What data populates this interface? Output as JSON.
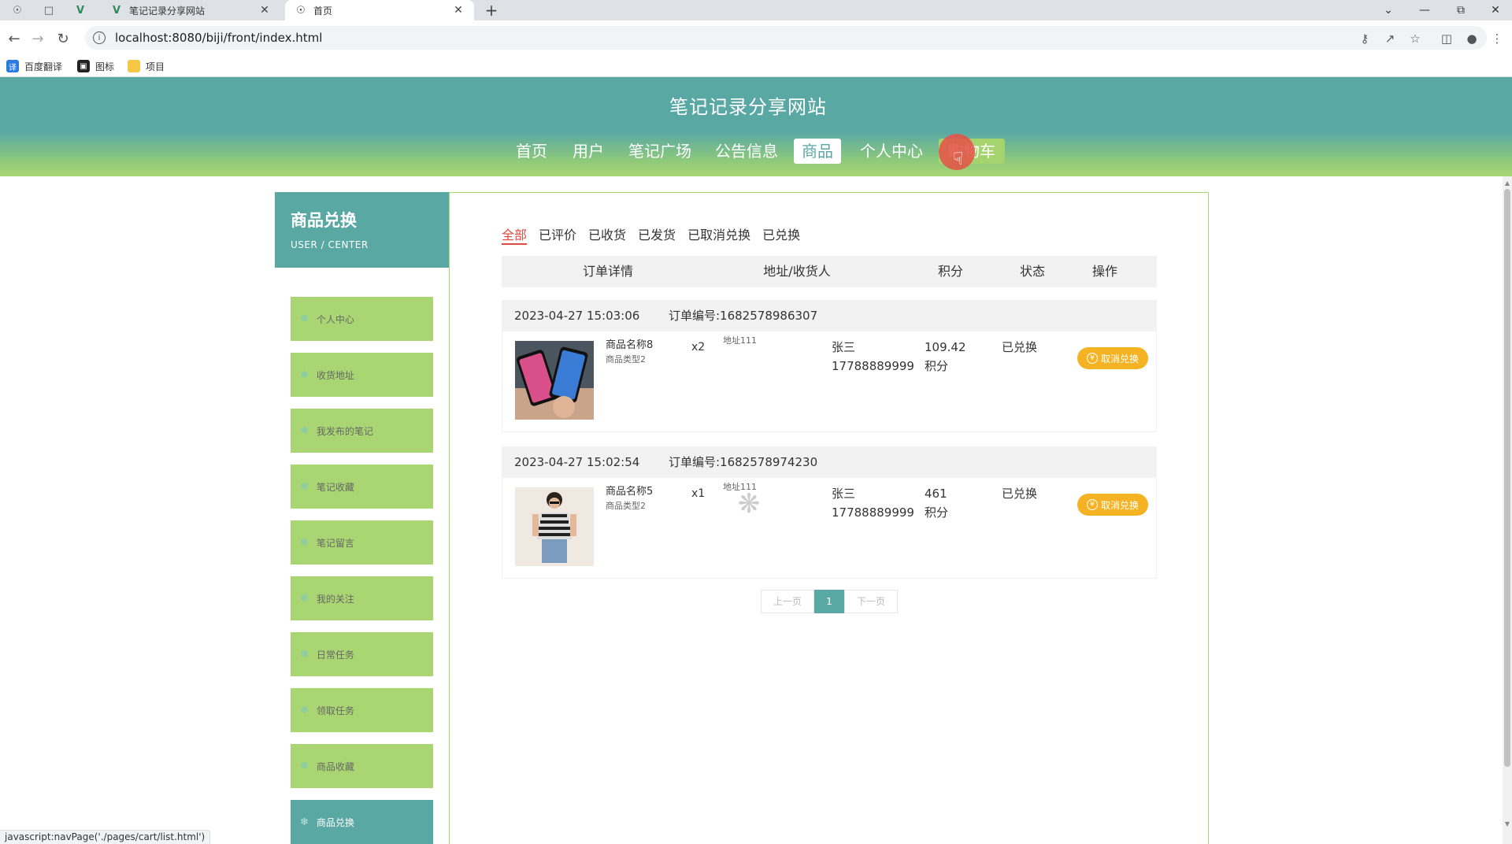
{
  "browser": {
    "tabs": [
      {
        "title": "笔记记录分享网站",
        "close": "✕"
      },
      {
        "title": "首页",
        "close": "✕"
      }
    ],
    "new_tab": "+",
    "url": "localhost:8080/biji/front/index.html",
    "bookmarks": [
      "百度翻译",
      "图标",
      "项目"
    ],
    "status_url": "javascript:navPage('./pages/cart/list.html')"
  },
  "site": {
    "title": "笔记记录分享网站",
    "nav": [
      "首页",
      "用户",
      "笔记广场",
      "公告信息",
      "商品",
      "个人中心",
      "购物车"
    ],
    "active_nav": "商品"
  },
  "sidebar": {
    "title": "商品兑换",
    "subtitle": "USER / CENTER",
    "items": [
      "个人中心",
      "收货地址",
      "我发布的笔记",
      "笔记收藏",
      "笔记留言",
      "我的关注",
      "日常任务",
      "领取任务",
      "商品收藏",
      "商品兑换"
    ],
    "active_item": "商品兑换"
  },
  "main": {
    "filters": [
      "全部",
      "已评价",
      "已收货",
      "已发货",
      "已取消兑换",
      "已兑换"
    ],
    "active_filter": "全部",
    "columns": [
      "订单详情",
      "地址/收货人",
      "积分",
      "状态",
      "操作"
    ],
    "orders": [
      {
        "time": "2023-04-27 15:03:06",
        "order_no": "订单编号:1682578986307",
        "product_name": "商品名称8",
        "product_type": "商品类型2",
        "qty": "x2",
        "address": "地址111",
        "receiver": "张三",
        "phone": "17788889999",
        "points": "109.42",
        "points_unit": "积分",
        "status": "已兑换",
        "action": "取消兑换"
      },
      {
        "time": "2023-04-27 15:02:54",
        "order_no": "订单编号:1682578974230",
        "product_name": "商品名称5",
        "product_type": "商品类型2",
        "qty": "x1",
        "address": "地址111",
        "receiver": "张三",
        "phone": "17788889999",
        "points": "461",
        "points_unit": "积分",
        "status": "已兑换",
        "action": "取消兑换"
      }
    ],
    "pager": {
      "prev": "上一页",
      "current": "1",
      "next": "下一页"
    }
  },
  "colors": {
    "primary": "#5aa8a4",
    "green": "#a9d672",
    "accent_red": "#e2483d",
    "button_orange": "#f5b324"
  }
}
